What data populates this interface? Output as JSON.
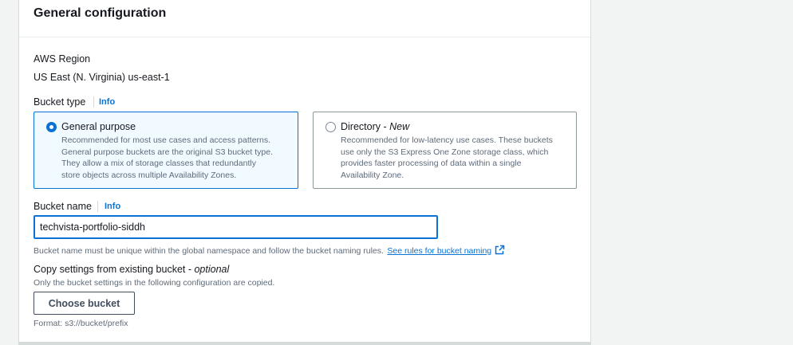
{
  "panel": {
    "title": "General configuration"
  },
  "region": {
    "label": "AWS Region",
    "value": "US East (N. Virginia) us-east-1"
  },
  "bucket_type": {
    "label": "Bucket type",
    "info": "Info",
    "options": [
      {
        "title": "General purpose",
        "title_suffix": "",
        "selected": true,
        "description": [
          "Recommended for most use cases and access patterns.",
          "General purpose buckets are the original S3 bucket type.",
          "They allow a mix of storage classes that redundantly",
          "store objects across multiple Availability Zones."
        ]
      },
      {
        "title": "Directory - ",
        "title_suffix": "New",
        "selected": false,
        "description": [
          "Recommended for low-latency use cases. These buckets",
          "use only the S3 Express One Zone storage class, which",
          "provides faster processing of data within a single",
          "Availability Zone."
        ]
      }
    ]
  },
  "bucket_name": {
    "label": "Bucket name",
    "info": "Info",
    "value": "techvista-portfolio-siddh",
    "hint": "Bucket name must be unique within the global namespace and follow the bucket naming rules.",
    "hint_link": "See rules for bucket naming"
  },
  "copy_settings": {
    "label": "Copy settings from existing bucket - ",
    "label_suffix": "optional",
    "description": "Only the bucket settings in the following configuration are copied.",
    "button": "Choose bucket",
    "format": "Format: s3://bucket/prefix"
  },
  "colors": {
    "accent": "#0972d3",
    "text": "#16191f",
    "secondary_text": "#5f6b7a",
    "background": "#f2f3f3"
  },
  "icons": {
    "radio_selected": "radio-checked-icon",
    "radio_unselected": "radio-unchecked-icon",
    "external_link": "external-link-icon"
  }
}
